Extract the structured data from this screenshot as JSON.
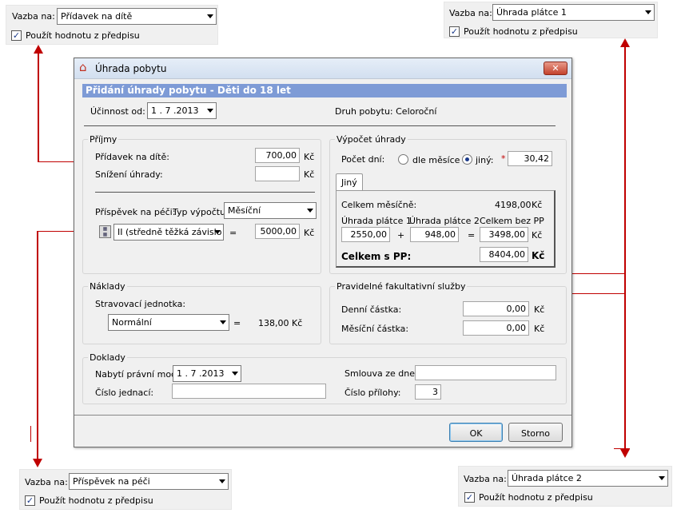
{
  "callouts": {
    "top_left": {
      "label": "Vazba na:",
      "value": "Přídavek na dítě",
      "checkbox": "Použít hodnotu z předpisu"
    },
    "top_right": {
      "label": "Vazba na:",
      "value": "Úhrada plátce 1",
      "checkbox": "Použít hodnotu z předpisu"
    },
    "bottom_left": {
      "label": "Vazba na:",
      "value": "Příspěvek na péči",
      "checkbox": "Použít hodnotu z předpisu"
    },
    "bottom_right": {
      "label": "Vazba na:",
      "value": "Úhrada plátce 2",
      "checkbox": "Použít hodnotu z předpisu"
    }
  },
  "dialog": {
    "title": "Úhrada pobytu",
    "header": "Přidání úhrady pobytu - Děti do 18 let",
    "ucinnost_label": "Účinnost od:",
    "ucinnost_value": "1 . 7 .2013",
    "druh_pobytu": "Druh pobytu: Celoroční",
    "prijmy": {
      "title": "Příjmy",
      "pridavek_label": "Přídavek na dítě:",
      "pridavek_value": "700,00",
      "snizeni_label": "Snížení úhrady:",
      "snizeni_value": "",
      "kc": "Kč",
      "prispevek_label": "Příspěvek na péči:",
      "typ_label": "Typ výpočtu:",
      "typ_value": "Měsíční",
      "stupen_value": "II (středně těžká závislo",
      "eq": "=",
      "prispevek_value": "5000,00"
    },
    "vypocet": {
      "title": "Výpočet úhrady",
      "pocet_dni_label": "Počet dní:",
      "radio_mesic": "dle měsíce",
      "radio_jiny": "jiný:",
      "asterisk": "*",
      "jiny_value": "30,42",
      "tab": "Jiný",
      "celkem_mesicne_label": "Celkem měsíčně:",
      "celkem_mesicne_value": "4198,00",
      "uhrada1_label": "Úhrada plátce 1",
      "uhrada2_label": "Úhrada plátce 2",
      "celkem_bez_label": "Celkem bez PP",
      "uhrada1_value": "2550,00",
      "plus": "+",
      "uhrada2_value": "948,00",
      "celkem_bez_value": "3498,00",
      "celkem_spp_label": "Celkem s PP:",
      "celkem_spp_value": "8404,00"
    },
    "naklady": {
      "title": "Náklady",
      "strav_label": "Stravovací jednotka:",
      "strav_value": "Normální",
      "strav_amount": "138,00"
    },
    "sluzby": {
      "title": "Pravidelné fakultativní služby",
      "denni_label": "Denní částka:",
      "denni_value": "0,00",
      "mesicni_label": "Měsíční částka:",
      "mesicni_value": "0,00"
    },
    "doklady": {
      "title": "Doklady",
      "nabyti_label": "Nabytí právní moci:",
      "nabyti_value": "1 . 7 .2013",
      "cislo_label": "Číslo jednací:",
      "cislo_value": "",
      "smlouva_label": "Smlouva ze dne:",
      "smlouva_value": "",
      "prilohy_label": "Číslo přílohy:",
      "prilohy_value": "3"
    },
    "ok": "OK",
    "storno": "Storno"
  }
}
